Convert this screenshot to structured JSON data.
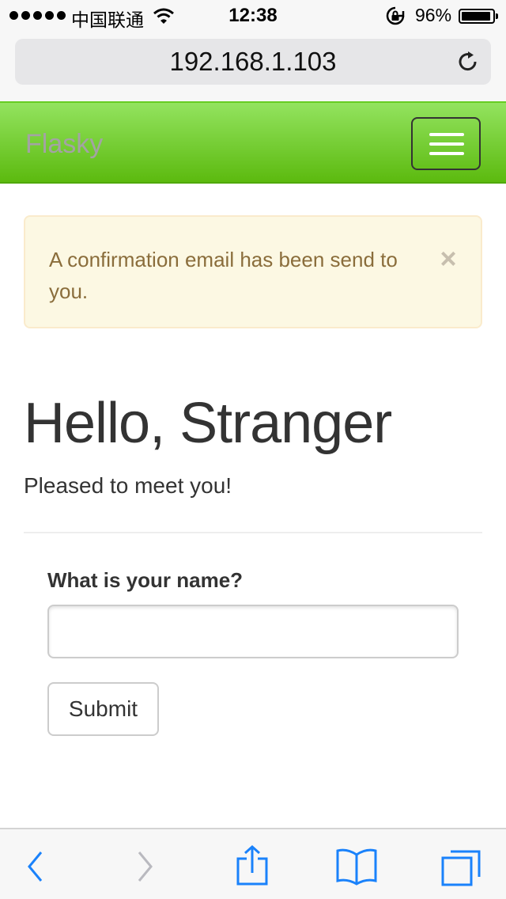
{
  "status_bar": {
    "carrier": "中国联通",
    "time": "12:38",
    "battery": "96%",
    "battery_level": 0.96
  },
  "browser": {
    "url": "192.168.1.103"
  },
  "navbar": {
    "brand": "Flasky"
  },
  "alert": {
    "message": "A confirmation email has been send to you.",
    "close_symbol": "×"
  },
  "page": {
    "title": "Hello, Stranger",
    "subtitle": "Pleased to meet you!"
  },
  "form": {
    "label": "What is your name?",
    "name_value": "",
    "submit_label": "Submit"
  },
  "colors": {
    "navbar_top": "#93e35f",
    "navbar_bottom": "#5cba0f",
    "alert_bg": "#fcf8e3",
    "alert_text": "#8a6d3b",
    "ios_blue": "#1a82fb"
  },
  "toolbar": {
    "icons": [
      "back-icon",
      "forward-icon",
      "share-icon",
      "bookmarks-icon",
      "tabs-icon"
    ]
  }
}
